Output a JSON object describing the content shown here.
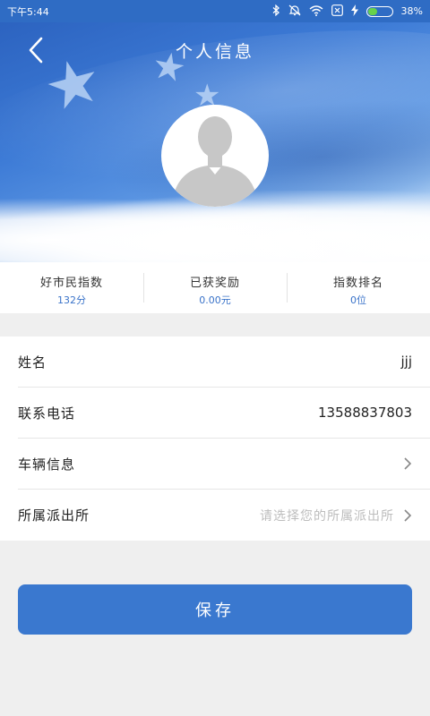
{
  "status_bar": {
    "time": "下午5:44",
    "icons": [
      "bluetooth-icon",
      "mute-icon",
      "wifi-icon",
      "sim-icon",
      "charging-icon",
      "battery-icon"
    ],
    "battery_text": "38%",
    "battery_level": 0.38
  },
  "header": {
    "title": "个人信息",
    "back_icon": "chevron-left-icon",
    "avatar_icon": "default-user-icon"
  },
  "stats": [
    {
      "label": "好市民指数",
      "value": "132分"
    },
    {
      "label": "已获奖励",
      "value": "0.00元"
    },
    {
      "label": "指数排名",
      "value": "0位"
    }
  ],
  "form": {
    "name": {
      "label": "姓名",
      "value": "jjj"
    },
    "phone": {
      "label": "联系电话",
      "value": "13588837803"
    },
    "vehicle": {
      "label": "车辆信息"
    },
    "police_station": {
      "label": "所属派出所",
      "placeholder": "请选择您的所属派出所"
    }
  },
  "save_button": {
    "label": "保存"
  },
  "colors": {
    "primary": "#3a78cf",
    "status_bar": "#2f6cc4",
    "stat_value": "#3a73c9",
    "background": "#efefef",
    "placeholder": "#bdbdbd"
  }
}
